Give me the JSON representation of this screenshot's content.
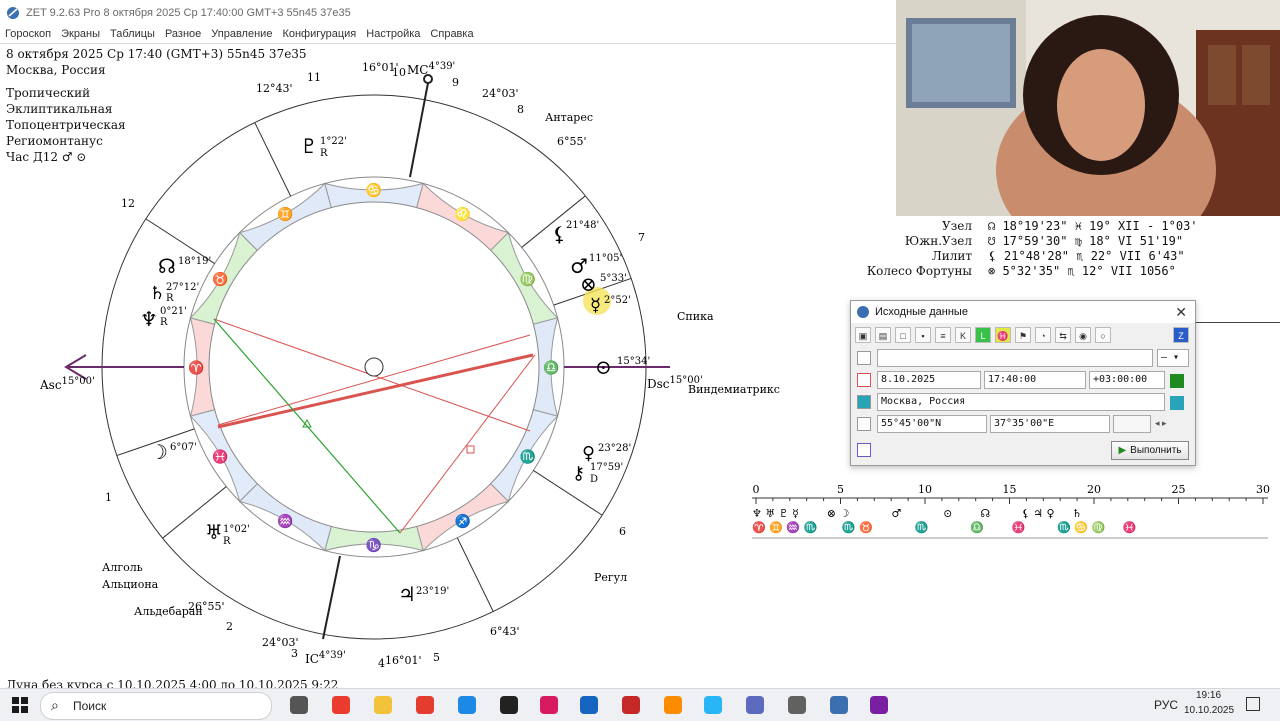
{
  "window": {
    "title": "ZET 9.2.63 Pro    8 октября 2025  Ср  17:40:00 GMT+3 55n45  37e35",
    "menu": [
      "Гороскоп",
      "Экраны",
      "Таблицы",
      "Разное",
      "Управление",
      "Конфигурация",
      "Настройка",
      "Справка"
    ]
  },
  "info": {
    "datetime": "8 октября 2025  Ср  17:40 (GMT+3) 55n45  37e35",
    "place": "Москва, Россия",
    "zodiac": "Тропический",
    "coords": "Эклиптикальная",
    "topo": "Топоцентрическая",
    "houses": "Региомонтанус",
    "hour": "Час Д12 ♂ ⊙"
  },
  "chart": {
    "colors": {
      "red": "#d9534f",
      "green": "#2fa12f",
      "outer": "#333333",
      "fire": "#fbd9d9",
      "earth": "#d8f2d2",
      "air": "#dfe9f8",
      "water": "#e2ebf9"
    },
    "axes": {
      "asc": "Asc",
      "asc_deg": "15°00'",
      "dsc": "Dsc",
      "dsc_deg": "15°00'",
      "mc": "MC",
      "mc_deg": "4°39'",
      "ic": "IC",
      "ic_deg": "4°39'"
    },
    "house_numbers": [
      "1",
      "2",
      "3",
      "4",
      "5",
      "6",
      "7",
      "8",
      "9",
      "10",
      "11",
      "12"
    ],
    "cusps": [
      {
        "label": "12°43'"
      },
      {
        "label": "16°01'"
      },
      {
        "label": "24°03'"
      },
      {
        "label": "6°55'"
      },
      {
        "label": "24°03'"
      },
      {
        "label": "16°01'"
      },
      {
        "label": "6°43'"
      },
      {
        "label": "26°55'"
      }
    ],
    "signs": [
      "♈",
      "♉",
      "♊",
      "♋",
      "♌",
      "♍",
      "♎",
      "♏",
      "♐",
      "♑",
      "♒",
      "♓"
    ],
    "planets": [
      {
        "glyph": "♇",
        "deg": "1°22'",
        "r": "R"
      },
      {
        "glyph": "⚸",
        "deg": "21°48'",
        "r": ""
      },
      {
        "glyph": "♂",
        "deg": "11°05'",
        "r": ""
      },
      {
        "glyph": "⊗",
        "deg": "5°33'",
        "r": ""
      },
      {
        "glyph": "☿",
        "deg": "2°52'",
        "r": ""
      },
      {
        "glyph": "⊙",
        "deg": "15°34'",
        "r": ""
      },
      {
        "glyph": "♀",
        "deg": "23°28'",
        "r": ""
      },
      {
        "glyph": "⚷",
        "deg": "17°59'",
        "r": "D"
      },
      {
        "glyph": "♃",
        "deg": "23°19'",
        "r": ""
      },
      {
        "glyph": "♅",
        "deg": "1°02'",
        "r": "R"
      },
      {
        "glyph": "☽",
        "deg": "6°07'",
        "r": ""
      },
      {
        "glyph": "♆",
        "deg": "0°21'",
        "r": "R"
      },
      {
        "glyph": "♄",
        "deg": "27°12'",
        "r": "R"
      },
      {
        "glyph": "☊",
        "deg": "18°19'",
        "r": ""
      }
    ],
    "stars": [
      "Антарес",
      "Спика",
      "Виндемиатрикс",
      "Регул",
      "Алголь",
      "Альциона",
      "Альдебаран"
    ]
  },
  "table": {
    "rows": [
      {
        "label": "Узел",
        "value": "☊  18°19'23\" ♓ 19° XII  - 1°03'"
      },
      {
        "label": "Южн.Узел",
        "value": "☋  17°59'30\" ♍ 18° VI    51'19\""
      },
      {
        "label": "Лилит",
        "value": "⚸  21°48'28\" ♏ 22° VII    6'43\""
      },
      {
        "label": "Колесо Фортуны",
        "value": "⊗   5°32'35\" ♏ 12° VII   1056°"
      }
    ]
  },
  "dialog": {
    "title": "Исходные данные",
    "name_value": "",
    "date": "8.10.2025",
    "time": "17:40:00",
    "tz": "+03:00:00",
    "place": "Москва, Россия",
    "lat": "55°45'00\"N",
    "lon": "37°35'00\"E",
    "run_label": "Выполнить"
  },
  "ephemeris": {
    "ticks": [
      "0",
      "5",
      "10",
      "15",
      "20",
      "25",
      "30"
    ],
    "row1": "♆ ♅ ♇ ☿        ⊗ ☽            ♂            ⊙        ☊         ⚸ ♃ ♀     ♄",
    "row2": "♈ ♊ ♒ ♏       ♏ ♉            ♏            ♎        ♓         ♏ ♋ ♍     ♓"
  },
  "status": "Луна без курса с 10.10.2025  4:00 до 10.10.2025  9:22",
  "taskbar": {
    "search": "Поиск",
    "lang": "РУС",
    "time": "19:16",
    "date": "10.10.2025"
  }
}
